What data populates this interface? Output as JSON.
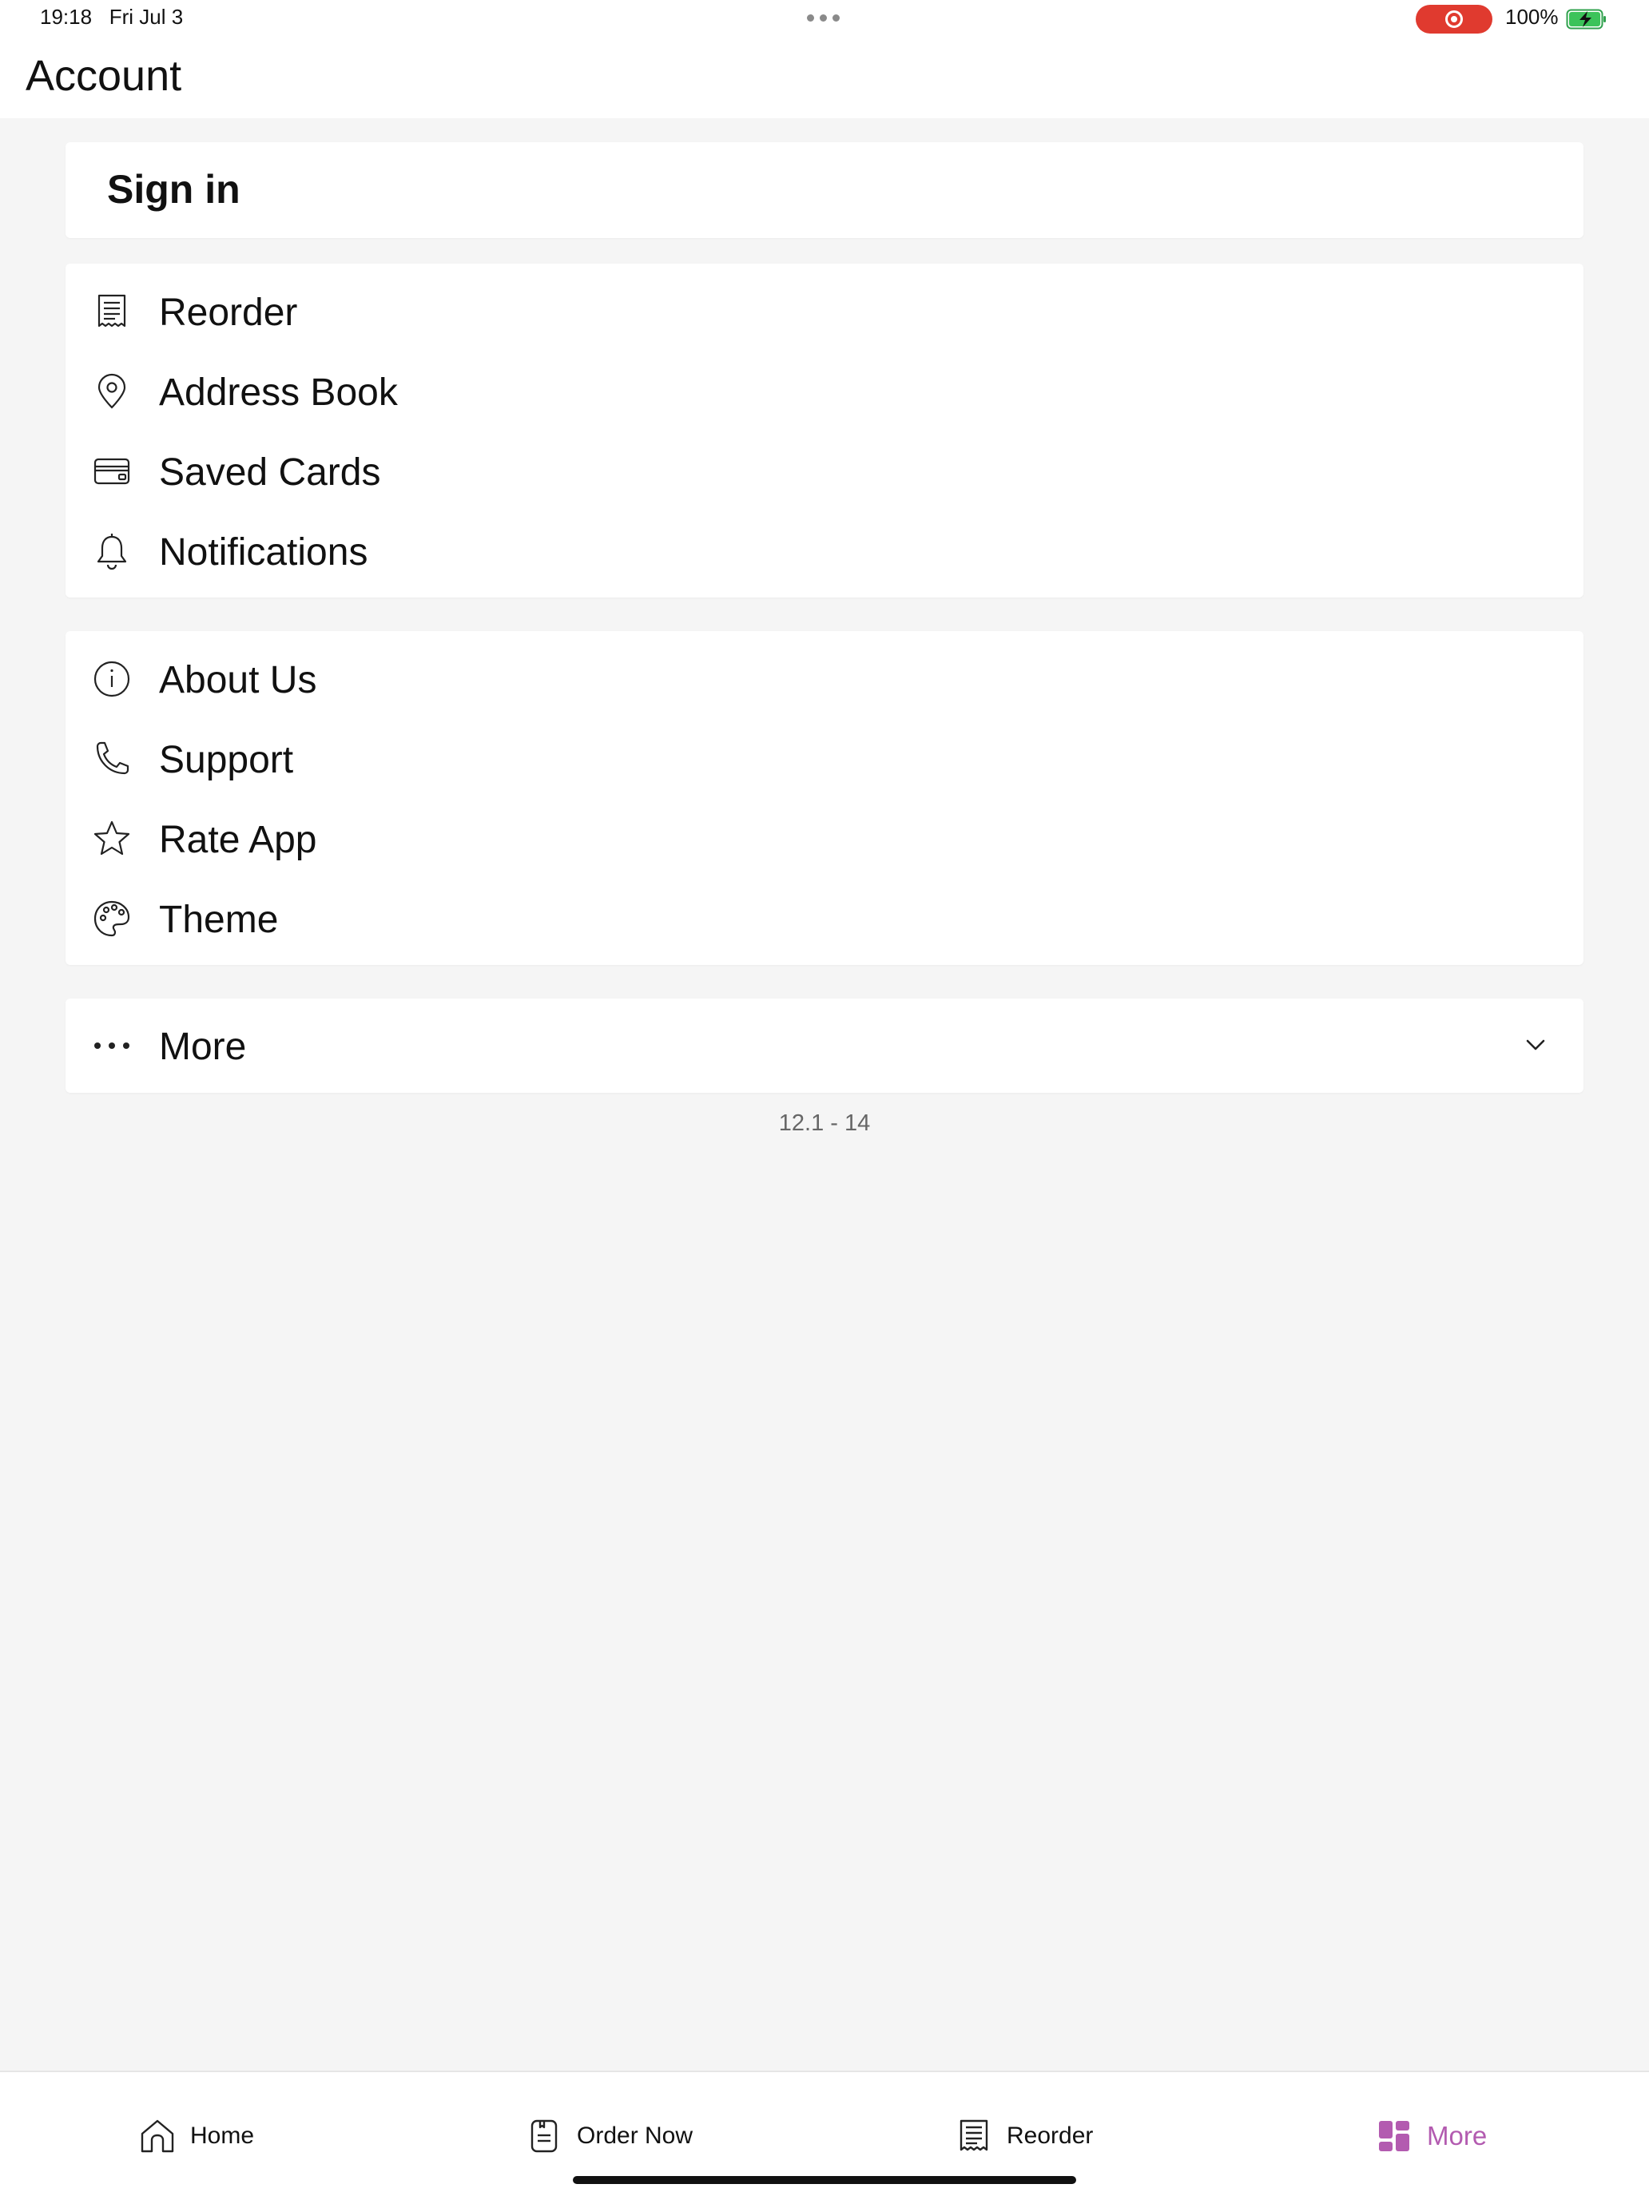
{
  "status_bar": {
    "time": "19:18",
    "date": "Fri Jul 3",
    "battery": "100%",
    "recording_color": "#e03a2f"
  },
  "header": {
    "title": "Account"
  },
  "signin": {
    "label": "Sign in"
  },
  "menu_group_1": [
    {
      "label": "Reorder",
      "icon": "receipt-icon"
    },
    {
      "label": "Address Book",
      "icon": "location-pin-icon"
    },
    {
      "label": "Saved Cards",
      "icon": "credit-card-icon"
    },
    {
      "label": "Notifications",
      "icon": "bell-icon"
    }
  ],
  "menu_group_2": [
    {
      "label": "About Us",
      "icon": "info-icon"
    },
    {
      "label": "Support",
      "icon": "phone-icon"
    },
    {
      "label": "Rate App",
      "icon": "star-icon"
    },
    {
      "label": "Theme",
      "icon": "palette-icon"
    }
  ],
  "more_section": {
    "label": "More",
    "icon": "ellipsis-icon",
    "expanded": false
  },
  "version": "12.1 - 14",
  "tab_bar": {
    "active_color": "#b35bb0",
    "tabs": [
      {
        "label": "Home",
        "icon": "home-icon",
        "active": false
      },
      {
        "label": "Order Now",
        "icon": "order-icon",
        "active": false
      },
      {
        "label": "Reorder",
        "icon": "receipt-icon",
        "active": false
      },
      {
        "label": "More",
        "icon": "grid-icon",
        "active": true
      }
    ]
  }
}
